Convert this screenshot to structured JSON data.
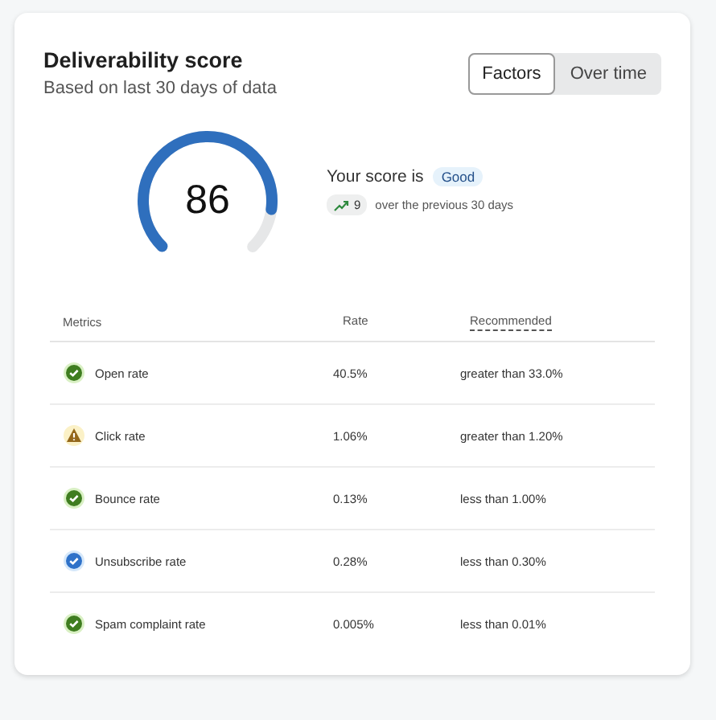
{
  "header": {
    "title": "Deliverability score",
    "subtitle": "Based on last 30 days of data"
  },
  "view_toggle": [
    {
      "label": "Factors",
      "selected": true
    },
    {
      "label": "Over time",
      "selected": false
    }
  ],
  "gauge": {
    "score": "86"
  },
  "summary": {
    "label": "Your score is",
    "rating": "Good",
    "change": "9",
    "change_text": "over the previous 30 days"
  },
  "table": {
    "columns": [
      "Metrics",
      "Rate",
      "Recommended"
    ],
    "rows": [
      {
        "kind": "ok",
        "metric": "Open rate",
        "rate": "40.5%",
        "recommended": "greater than 33.0%"
      },
      {
        "kind": "warning",
        "metric": "Click rate",
        "rate": "1.06%",
        "recommended": "greater than 1.20%"
      },
      {
        "kind": "ok",
        "metric": "Bounce rate",
        "rate": "0.13%",
        "recommended": "less than 1.00%"
      },
      {
        "kind": "info",
        "metric": "Unsubscribe rate",
        "rate": "0.28%",
        "recommended": "less than 0.30%"
      },
      {
        "kind": "ok",
        "metric": "Spam complaint rate",
        "rate": "0.005%",
        "recommended": "less than 0.01%"
      }
    ]
  }
}
